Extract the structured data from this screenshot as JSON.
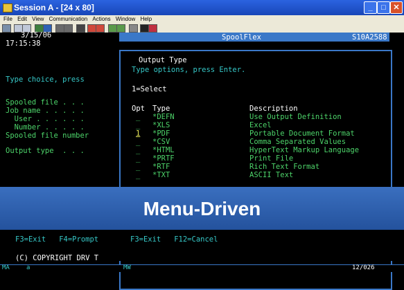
{
  "window": {
    "title": "Session A - [24 x 80]"
  },
  "menu": [
    "File",
    "Edit",
    "View",
    "Communication",
    "Actions",
    "Window",
    "Help"
  ],
  "screen": {
    "date": "3/15/06",
    "time": "17:15:38",
    "app_name": "SpoolFlex",
    "system": "S10A2588",
    "left_prompt": "Type choice, press",
    "left_labels": [
      "Spooled file . . .",
      "Job name . . . . .",
      "  User . . . . . .",
      "  Number . . . . .",
      "Spooled file number",
      "Output type  . . ."
    ],
    "left_fkeys": "F3=Exit   F4=Prompt",
    "copyright": "(C) COPYRIGHT DRV T",
    "window": {
      "title": "Output Type",
      "instructions": "Type options, press Enter.",
      "option": "1=Select",
      "col_opt": "Opt",
      "col_type": "Type",
      "col_desc": "Description",
      "rows": [
        {
          "opt": "_",
          "type": "*DEFN",
          "desc": "Use Output Definition"
        },
        {
          "opt": "_",
          "type": "*XLS",
          "desc": "Excel"
        },
        {
          "opt": "1",
          "type": "*PDF",
          "desc": "Portable Document Format"
        },
        {
          "opt": "_",
          "type": "*CSV",
          "desc": "Comma Separated Values"
        },
        {
          "opt": "_",
          "type": "*HTML",
          "desc": "HyperText Markup Language"
        },
        {
          "opt": "_",
          "type": "*PRTF",
          "desc": "Print File"
        },
        {
          "opt": "_",
          "type": "*RTF",
          "desc": "Rich Text Format"
        },
        {
          "opt": "_",
          "type": "*TXT",
          "desc": "ASCII Text"
        }
      ],
      "fkeys": "F3=Exit   F12=Cancel"
    }
  },
  "banner": "Menu-Driven",
  "status": {
    "left": "MA",
    "session": "a",
    "mode": "MW",
    "position": "12/026"
  }
}
